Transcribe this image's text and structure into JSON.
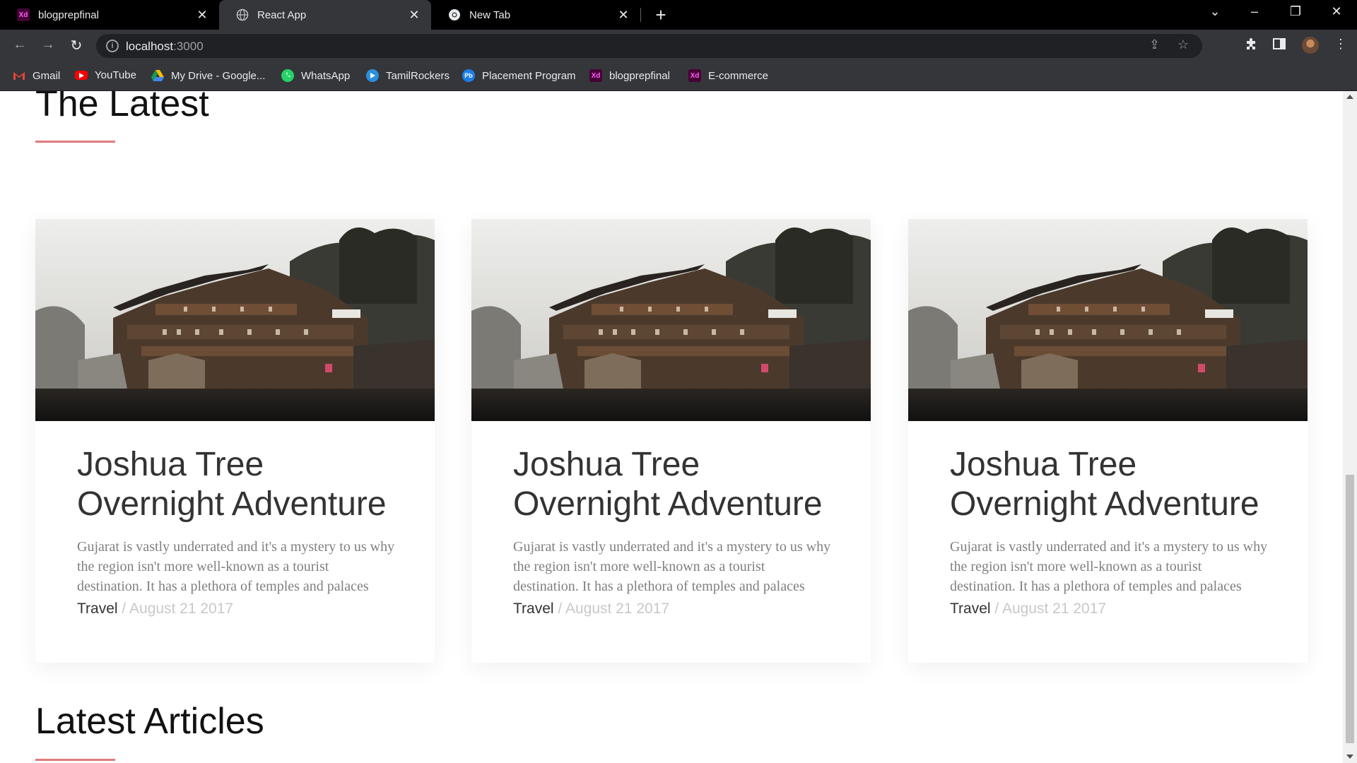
{
  "browser": {
    "tabs": [
      {
        "title": "blogprepfinal",
        "favicon": "xd-icon",
        "active": false
      },
      {
        "title": "React App",
        "favicon": "globe-icon",
        "active": true
      },
      {
        "title": "New Tab",
        "favicon": "chrome-icon",
        "active": false
      }
    ],
    "address": {
      "host": "localhost",
      "port": ":3000"
    },
    "bookmarks": [
      {
        "label": "Gmail",
        "icon": "gmail-icon",
        "color": "#ea4335"
      },
      {
        "label": "YouTube",
        "icon": "youtube-icon",
        "color": "#ff0000"
      },
      {
        "label": "My Drive - Google...",
        "icon": "drive-icon",
        "color": "#fbbc04"
      },
      {
        "label": "WhatsApp",
        "icon": "whatsapp-icon",
        "color": "#25d366"
      },
      {
        "label": "TamilRockers",
        "icon": "tamilrockers-icon",
        "color": "#2b8fe0"
      },
      {
        "label": "Placement Program",
        "icon": "placement-icon",
        "color": "#1c7fe8"
      },
      {
        "label": "blogprepfinal",
        "icon": "xd-icon",
        "color": "#470137"
      },
      {
        "label": "E-commerce",
        "icon": "xd-icon",
        "color": "#470137"
      }
    ]
  },
  "page": {
    "latest_title": "The Latest",
    "articles_title": "Latest Articles",
    "accent_color": "#e07b7b",
    "cards": [
      {
        "title_line1": "Joshua Tree",
        "title_line2": "Overnight Adventure",
        "excerpt": "Gujarat is vastly underrated and it's a mystery to us why the region isn't more well-known as a tourist destination. It has a plethora of temples and palaces",
        "category": "Travel",
        "separator": "/",
        "date": "August 21 2017"
      },
      {
        "title_line1": "Joshua Tree",
        "title_line2": "Overnight Adventure",
        "excerpt": "Gujarat is vastly underrated and it's a mystery to us why the region isn't more well-known as a tourist destination. It has a plethora of temples and palaces",
        "category": "Travel",
        "separator": "/",
        "date": "August 21 2017"
      },
      {
        "title_line1": "Joshua Tree",
        "title_line2": "Overnight Adventure",
        "excerpt": "Gujarat is vastly underrated and it's a mystery to us why the region isn't more well-known as a tourist destination. It has a plethora of temples and palaces",
        "category": "Travel",
        "separator": "/",
        "date": "August 21 2017"
      }
    ]
  }
}
